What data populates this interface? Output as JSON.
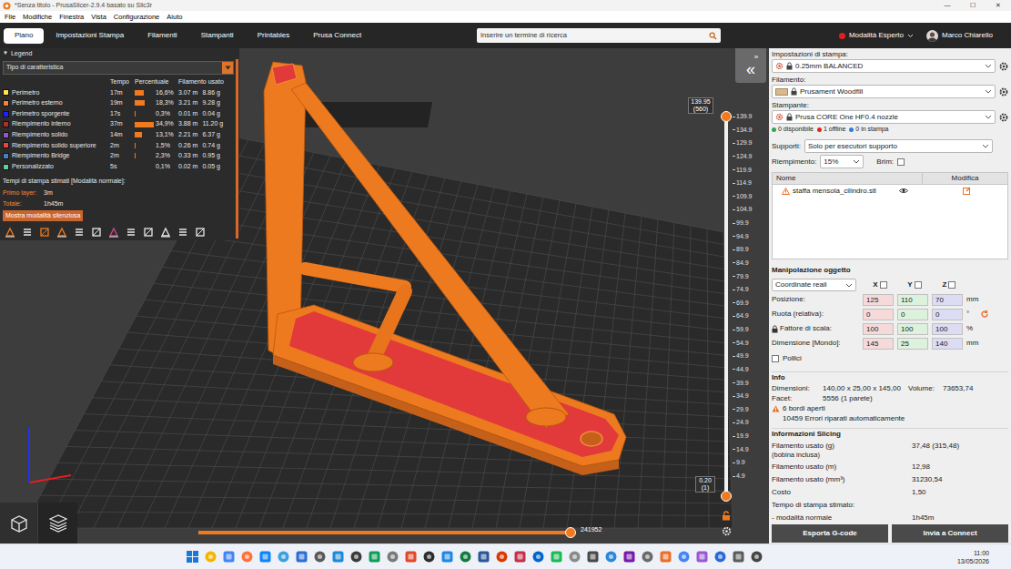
{
  "window": {
    "title": "*Senza titolo - PrusaSlicer-2.9.4 basato su Slic3r",
    "controls": [
      "—",
      "☐",
      "✕"
    ]
  },
  "menu": [
    "File",
    "Modifiche",
    "Finestra",
    "Vista",
    "Configurazione",
    "Aiuto"
  ],
  "tabs": [
    {
      "label": "Piano",
      "selected": true
    },
    {
      "label": "Impostazioni Stampa",
      "selected": false
    },
    {
      "label": "Filamenti",
      "selected": false
    },
    {
      "label": "Stampanti",
      "selected": false
    },
    {
      "label": "Printables",
      "selected": false
    },
    {
      "label": "Prusa Connect",
      "selected": false
    }
  ],
  "search": {
    "placeholder": "Inserire un termine di ricerca"
  },
  "mode": {
    "label": "Modalità Esperto"
  },
  "user": {
    "name": "Marco Chiarello"
  },
  "legend": {
    "toggle": "▼",
    "title": "Legend",
    "view": "Tipo di caratteristica",
    "columns": [
      "Tempo",
      "Percentuale",
      "Filamento usato"
    ],
    "rows": [
      {
        "name": "Perimetro",
        "time": "17m",
        "percent": "16,6%",
        "level": 0.476,
        "length": "3.07 m",
        "weight": "8.86 g",
        "color": "#ffe64d"
      },
      {
        "name": "Perimetro esterno",
        "time": "19m",
        "percent": "18,3%",
        "level": 0.524,
        "length": "3.21 m",
        "weight": "9.28 g",
        "color": "#ff7d38"
      },
      {
        "name": "Perimetro sporgente",
        "time": "17s",
        "percent": "0,3%",
        "level": 0.009,
        "length": "0.01 m",
        "weight": "0.04 g",
        "color": "#1f1fff"
      },
      {
        "name": "Riempimento interno",
        "time": "37m",
        "percent": "34,9%",
        "level": 1,
        "length": "3.88 m",
        "weight": "11.20 g",
        "color": "#b03029"
      },
      {
        "name": "Riempimento solido",
        "time": "14m",
        "percent": "13,1%",
        "level": 0.375,
        "length": "2.21 m",
        "weight": "6.37 g",
        "color": "#9654cc"
      },
      {
        "name": "Riempimento solido superiore",
        "time": "2m",
        "percent": "1,5%",
        "level": 0.043,
        "length": "0.26 m",
        "weight": "0.74 g",
        "color": "#f04040"
      },
      {
        "name": "Riempimento Bridge",
        "time": "2m",
        "percent": "2,3%",
        "level": 0.066,
        "length": "0.33 m",
        "weight": "0.95 g",
        "color": "#4d80ba"
      },
      {
        "name": "Personalizzato",
        "time": "5s",
        "percent": "0,1%",
        "level": 0.003,
        "length": "0.02 m",
        "weight": "0.05 g",
        "color": "#5ed194"
      }
    ],
    "times_title": "Tempi di stampa stimati [Modalità normale]:",
    "times": [
      {
        "label": "Primo layer:",
        "value": "3m"
      },
      {
        "label": "Totale:",
        "value": "1h45m"
      }
    ],
    "button": "Mostra modalità silenziosa"
  },
  "view": {
    "sidebar_toggle": [
      "»",
      "«"
    ],
    "vertical_slider": {
      "upper": {
        "value": "139.95",
        "layer": "(560)",
        "level": 1
      },
      "lower": {
        "value": "0.20",
        "layer": "(1)",
        "level": 0
      },
      "ticks": [
        "139.9",
        "134.9",
        "129.9",
        "124.9",
        "119.9",
        "114.9",
        "109.9",
        "104.9",
        "99.9",
        "94.9",
        "89.9",
        "84.9",
        "79.9",
        "74.9",
        "69.9",
        "64.9",
        "59.9",
        "54.9",
        "49.9",
        "44.9",
        "39.9",
        "34.9",
        "29.9",
        "24.9",
        "19.9",
        "14.9",
        "9.9",
        "4.9"
      ]
    },
    "horizontal_slider": {
      "label": "241952",
      "level": 1
    }
  },
  "sidebar": {
    "print_settings": {
      "label": "Impostazioni di stampa:",
      "value": "0.25mm BALANCED"
    },
    "filament": {
      "label": "Filamento:",
      "value": "Prusament Woodfill"
    },
    "printer": {
      "label": "Stampante:",
      "value": "Prusa CORE One HF0.4 nozzle"
    },
    "printer_status": [
      {
        "text": "0 disponibile",
        "color": "#2fa84f"
      },
      {
        "text": "1 offline",
        "color": "#e02424"
      },
      {
        "text": "0 in stampa",
        "color": "#2d7fd6"
      }
    ],
    "supports": {
      "label": "Supporti:",
      "value": "Solo per esecutori supporto"
    },
    "infill": {
      "label": "Riempimento:",
      "value": "15%"
    },
    "brim": {
      "label": "Brim:",
      "checked": false
    },
    "object_list": {
      "columns": [
        "Nome",
        "Modifica"
      ],
      "rows": [
        {
          "name": "staffa mensola_cilindro.stl",
          "warning": true,
          "visible": true
        }
      ]
    },
    "manipulation": {
      "title": "Manipolazione oggetto",
      "coords": "Coordinate reali",
      "axes": [
        {
          "label": "X",
          "checked": false,
          "color": "#f6dada"
        },
        {
          "label": "Y",
          "checked": false,
          "color": "#dcf2dc"
        },
        {
          "label": "Z",
          "checked": false,
          "color": "#dcdcf4"
        }
      ],
      "rows": [
        {
          "label": "Posizione:",
          "values": [
            "125",
            "110",
            "70"
          ],
          "unit": "mm"
        },
        {
          "label": "Ruota (relativa):",
          "values": [
            "0",
            "0",
            "0"
          ],
          "unit": "°"
        },
        {
          "label": "Fattore di scala:",
          "values": [
            "100",
            "100",
            "100"
          ],
          "unit": "%"
        },
        {
          "label": "Dimensione [Mondo]:",
          "values": [
            "145",
            "25",
            "140"
          ],
          "unit": "mm"
        }
      ],
      "scale_locked": true,
      "inches": {
        "label": "Pollici",
        "checked": false
      }
    },
    "info": {
      "title": "Info",
      "dimensions": {
        "label": "Dimensioni:",
        "value": "140,00 x 25,00 x 145,00"
      },
      "volume": {
        "label": "Volume:",
        "value": "73653,74"
      },
      "facets": {
        "label": "Facet:",
        "value": "5556 (1 parete)"
      },
      "warning": "6 bordi aperti",
      "repaired": "10459 Errori riparati automaticamente"
    },
    "slicing": {
      "title": "Informazioni Slicing",
      "rows": [
        {
          "label": "Filamento usato (g)",
          "sub": "(bobina inclusa)",
          "value": "37,48 (315,48)"
        },
        {
          "label": "Filamento usato (m)",
          "value": "12,98"
        },
        {
          "label": "Filamento usato (mm³)",
          "value": "31230,54"
        },
        {
          "label": "Costo",
          "value": "1,50"
        },
        {
          "label": "Tempo di stampa stimato:"
        },
        {
          "label": "- modalità normale",
          "value": "1h45m"
        }
      ]
    },
    "actions": [
      "Esporta G-code",
      "Invia a Connect"
    ]
  },
  "taskbar": {
    "time": "11:00",
    "date": "13/05/2026"
  }
}
